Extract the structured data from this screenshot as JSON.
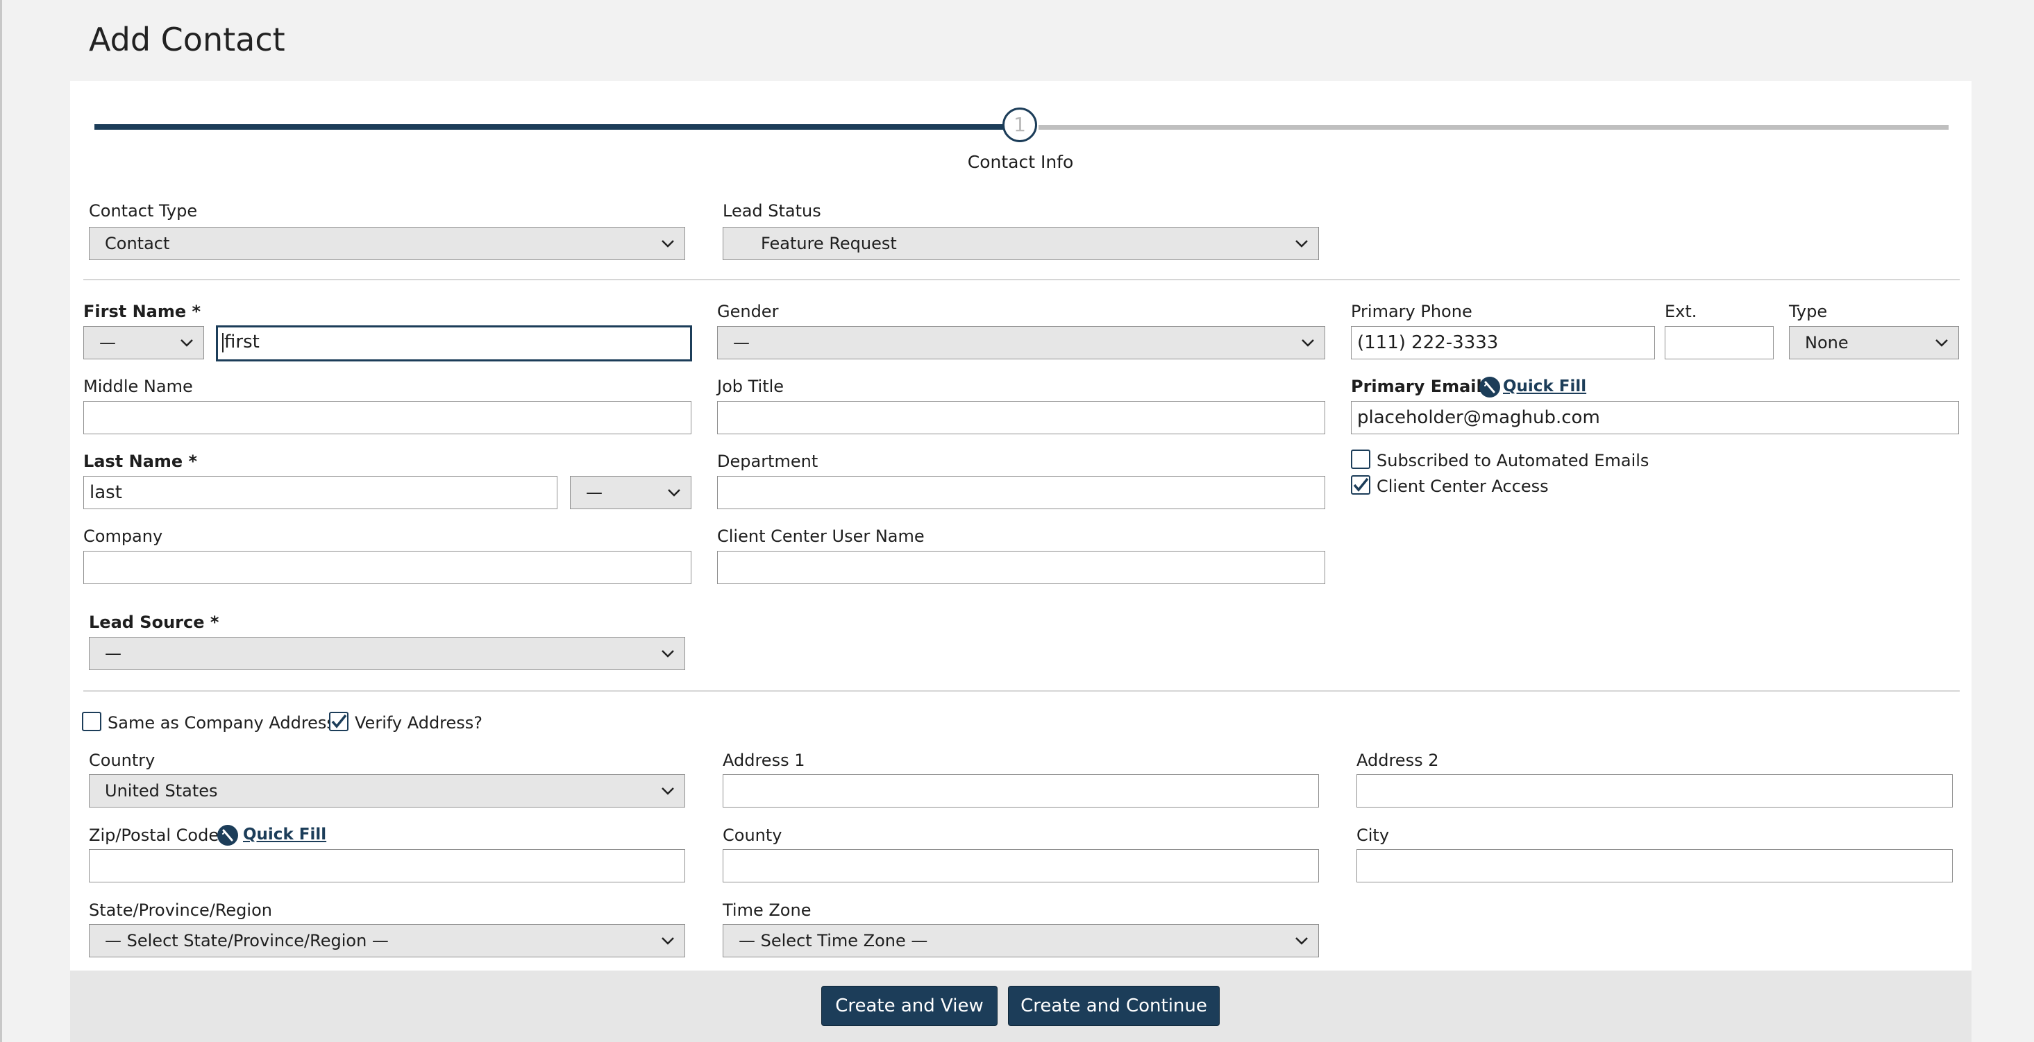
{
  "page_title": "Add Contact",
  "stepper": {
    "step_number": "1",
    "step_label": "Contact Info"
  },
  "contact_type": {
    "label": "Contact Type",
    "value": "Contact"
  },
  "lead_status": {
    "label": "Lead Status",
    "value": "Feature Request"
  },
  "first_name": {
    "label": "First Name *",
    "prefix_value": "—",
    "value": "first"
  },
  "middle_name": {
    "label": "Middle Name",
    "value": ""
  },
  "last_name": {
    "label": "Last Name *",
    "value": "last",
    "suffix_value": "—"
  },
  "company": {
    "label": "Company",
    "value": ""
  },
  "lead_source": {
    "label": "Lead Source *",
    "value": "—"
  },
  "gender": {
    "label": "Gender",
    "value": "—"
  },
  "job_title": {
    "label": "Job Title",
    "value": ""
  },
  "department": {
    "label": "Department",
    "value": ""
  },
  "client_center_user_name": {
    "label": "Client Center User Name",
    "value": ""
  },
  "primary_phone": {
    "label": "Primary Phone",
    "value": "(111) 222-3333"
  },
  "ext": {
    "label": "Ext.",
    "value": ""
  },
  "phone_type": {
    "label": "Type",
    "value": "None"
  },
  "primary_email": {
    "label": "Primary Email *",
    "quick_fill_label": "Quick Fill",
    "value": "placeholder@maghub.com"
  },
  "subscribed_emails": {
    "label": "Subscribed to Automated Emails",
    "checked": false
  },
  "client_center_access": {
    "label": "Client Center Access",
    "checked": true
  },
  "same_as_company": {
    "label": "Same as Company Address?",
    "checked": false
  },
  "verify_address": {
    "label": "Verify Address?",
    "checked": true
  },
  "country": {
    "label": "Country",
    "value": "United States"
  },
  "address1": {
    "label": "Address 1",
    "value": ""
  },
  "address2": {
    "label": "Address 2",
    "value": ""
  },
  "zip": {
    "label": "Zip/Postal Code",
    "quick_fill_label": "Quick Fill",
    "value": ""
  },
  "county": {
    "label": "County",
    "value": ""
  },
  "city": {
    "label": "City",
    "value": ""
  },
  "state": {
    "label": "State/Province/Region",
    "value": "— Select State/Province/Region —"
  },
  "time_zone": {
    "label": "Time Zone",
    "value": "— Select Time Zone —"
  },
  "buttons": {
    "create_and_view": "Create and View",
    "create_and_continue": "Create and Continue"
  },
  "colors": {
    "primary": "#1c3d59",
    "field_grey": "#e6e6e6",
    "page_bg": "#f2f2f2"
  }
}
